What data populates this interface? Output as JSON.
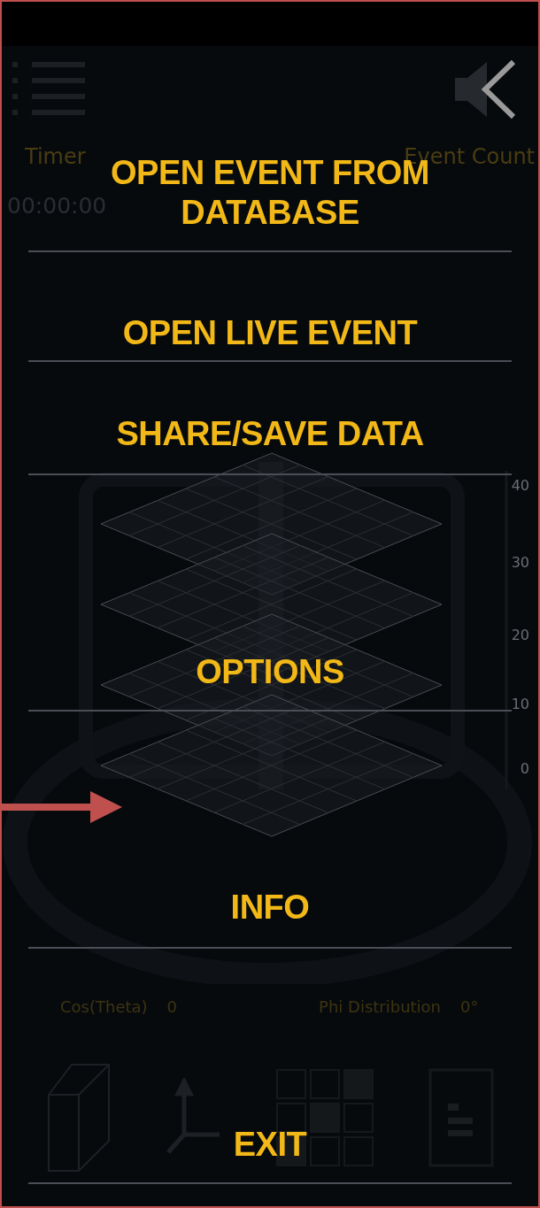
{
  "header": {
    "stats_labels": [
      "Timer",
      "Event Count"
    ],
    "stats_values": [
      "00:00:00"
    ]
  },
  "chart": {
    "axis_ticks": [
      "40",
      "30",
      "20",
      "10",
      "0"
    ]
  },
  "distribution": [
    {
      "label": "Cos(Theta)",
      "value": "0"
    },
    {
      "label": "Phi Distribution",
      "value": "0°"
    }
  ],
  "menu": [
    {
      "label": "OPEN EVENT FROM DATABASE"
    },
    {
      "label": "OPEN LIVE EVENT"
    },
    {
      "label": "SHARE/SAVE DATA"
    },
    {
      "label": "OPTIONS"
    },
    {
      "label": "INFO"
    },
    {
      "label": "EXIT"
    }
  ]
}
